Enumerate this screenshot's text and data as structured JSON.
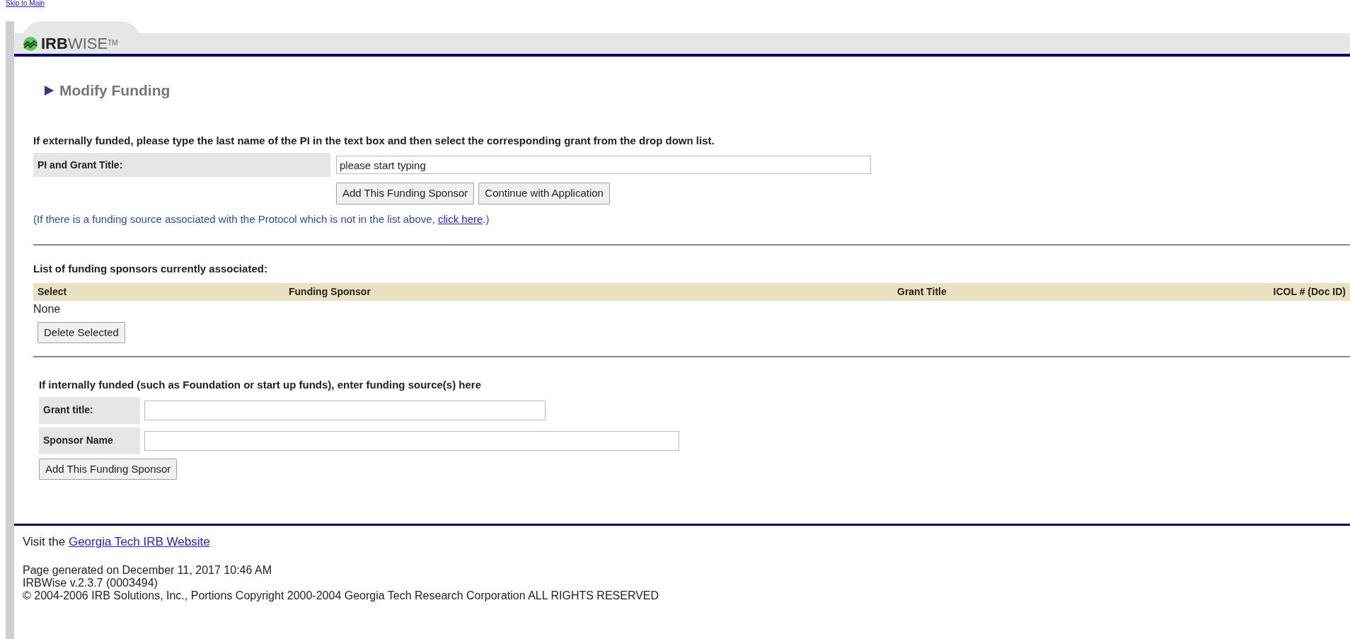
{
  "skip_link": "Skip to Main",
  "logo": {
    "bold": "IRB",
    "light": "WISE",
    "mark": "TM"
  },
  "page_title": "Modify Funding",
  "external": {
    "instruction": "If externally funded, please type the last name of the PI in the text box and then select the corresponding grant from the drop down list.",
    "label": "PI and Grant Title:",
    "placeholder": "please start typing",
    "buttons": [
      "Add This Funding Sponsor",
      "Continue with Application"
    ],
    "note_before": "(If there is a funding source associated with the Protocol which is not in the list above, ",
    "note_link": "click here",
    "note_after": ".)"
  },
  "sponsors": {
    "heading": "List of funding sponsors currently associated:",
    "columns": [
      "Select",
      "Funding Sponsor",
      "Grant Title",
      "ICOL # (Doc ID)"
    ],
    "empty": "None",
    "button": "Delete Selected"
  },
  "internal": {
    "heading": "If internally funded (such as Foundation or start up funds), enter funding source(s) here",
    "fields": [
      {
        "label": "Grant title:"
      },
      {
        "label": "Sponsor Name"
      }
    ],
    "button": "Add This Funding Sponsor"
  },
  "footer": {
    "visit": "Visit the",
    "link": "Georgia Tech IRB Website",
    "lines": [
      "Page generated on December 11, 2017 10:46 AM",
      "IRBWise v.2.3.7 (0003494)",
      "© 2004-2006 IRB Solutions, Inc., Portions Copyright 2000-2004 Georgia Tech Research Corporation ALL RIGHTS RESERVED"
    ]
  }
}
